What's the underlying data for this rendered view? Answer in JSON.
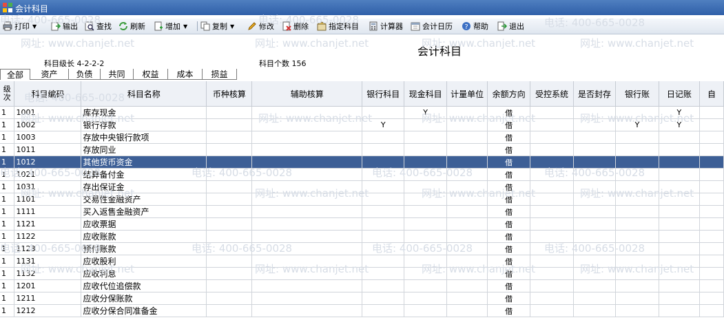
{
  "window": {
    "title": "会计科目"
  },
  "toolbar": {
    "print": "打印",
    "export": "输出",
    "find": "查找",
    "refresh": "刷新",
    "add": "增加",
    "copy": "复制",
    "modify": "修改",
    "delete": "删除",
    "designate": "指定科目",
    "calculator": "计算器",
    "calendar": "会计日历",
    "help": "帮助",
    "exit": "退出"
  },
  "watermark": {
    "phone": "电话: 400-665-0028",
    "site": "网址: www.chanjet.net"
  },
  "page": {
    "heading": "会计科目",
    "level_info": "科目级长 4-2-2-2",
    "count_info": "科目个数 156"
  },
  "tabs": [
    "全部",
    "资产",
    "负债",
    "共同",
    "权益",
    "成本",
    "损益"
  ],
  "columns": [
    "级次",
    "科目编码",
    "科目名称",
    "币种核算",
    "辅助核算",
    "银行科目",
    "现金科目",
    "计量单位",
    "余额方向",
    "受控系统",
    "是否封存",
    "银行账",
    "日记账",
    "自"
  ],
  "rows": [
    {
      "level": "1",
      "code": "1001",
      "name": "库存现金",
      "bank": "",
      "cash": "Y",
      "dir": "借",
      "bankbook": "",
      "journal": "Y"
    },
    {
      "level": "1",
      "code": "1002",
      "name": "银行存款",
      "bank": "Y",
      "cash": "",
      "dir": "借",
      "bankbook": "Y",
      "journal": "Y"
    },
    {
      "level": "1",
      "code": "1003",
      "name": "存放中央银行款项",
      "bank": "",
      "cash": "",
      "dir": "借",
      "bankbook": "",
      "journal": ""
    },
    {
      "level": "1",
      "code": "1011",
      "name": "存放同业",
      "bank": "",
      "cash": "",
      "dir": "借",
      "bankbook": "",
      "journal": ""
    },
    {
      "level": "1",
      "code": "1012",
      "name": "其他货币资金",
      "bank": "",
      "cash": "",
      "dir": "借",
      "bankbook": "",
      "journal": ""
    },
    {
      "level": "1",
      "code": "1021",
      "name": "结算备付金",
      "bank": "",
      "cash": "",
      "dir": "借",
      "bankbook": "",
      "journal": ""
    },
    {
      "level": "1",
      "code": "1031",
      "name": "存出保证金",
      "bank": "",
      "cash": "",
      "dir": "借",
      "bankbook": "",
      "journal": ""
    },
    {
      "level": "1",
      "code": "1101",
      "name": "交易性金融资产",
      "bank": "",
      "cash": "",
      "dir": "借",
      "bankbook": "",
      "journal": ""
    },
    {
      "level": "1",
      "code": "1111",
      "name": "买入返售金融资产",
      "bank": "",
      "cash": "",
      "dir": "借",
      "bankbook": "",
      "journal": ""
    },
    {
      "level": "1",
      "code": "1121",
      "name": "应收票据",
      "bank": "",
      "cash": "",
      "dir": "借",
      "bankbook": "",
      "journal": ""
    },
    {
      "level": "1",
      "code": "1122",
      "name": "应收账款",
      "bank": "",
      "cash": "",
      "dir": "借",
      "bankbook": "",
      "journal": ""
    },
    {
      "level": "1",
      "code": "1123",
      "name": "预付账款",
      "bank": "",
      "cash": "",
      "dir": "借",
      "bankbook": "",
      "journal": ""
    },
    {
      "level": "1",
      "code": "1131",
      "name": "应收股利",
      "bank": "",
      "cash": "",
      "dir": "借",
      "bankbook": "",
      "journal": ""
    },
    {
      "level": "1",
      "code": "1132",
      "name": "应收利息",
      "bank": "",
      "cash": "",
      "dir": "借",
      "bankbook": "",
      "journal": ""
    },
    {
      "level": "1",
      "code": "1201",
      "name": "应收代位追偿款",
      "bank": "",
      "cash": "",
      "dir": "借",
      "bankbook": "",
      "journal": ""
    },
    {
      "level": "1",
      "code": "1211",
      "name": "应收分保账款",
      "bank": "",
      "cash": "",
      "dir": "借",
      "bankbook": "",
      "journal": ""
    },
    {
      "level": "1",
      "code": "1212",
      "name": "应收分保合同准备金",
      "bank": "",
      "cash": "",
      "dir": "借",
      "bankbook": "",
      "journal": ""
    }
  ],
  "selected_row_index": 4,
  "colors": {
    "titlebar": "#3a6cb4",
    "selection": "#3d5f96",
    "header_bg": "#eef1f6",
    "watermark": "#d7dde6"
  }
}
